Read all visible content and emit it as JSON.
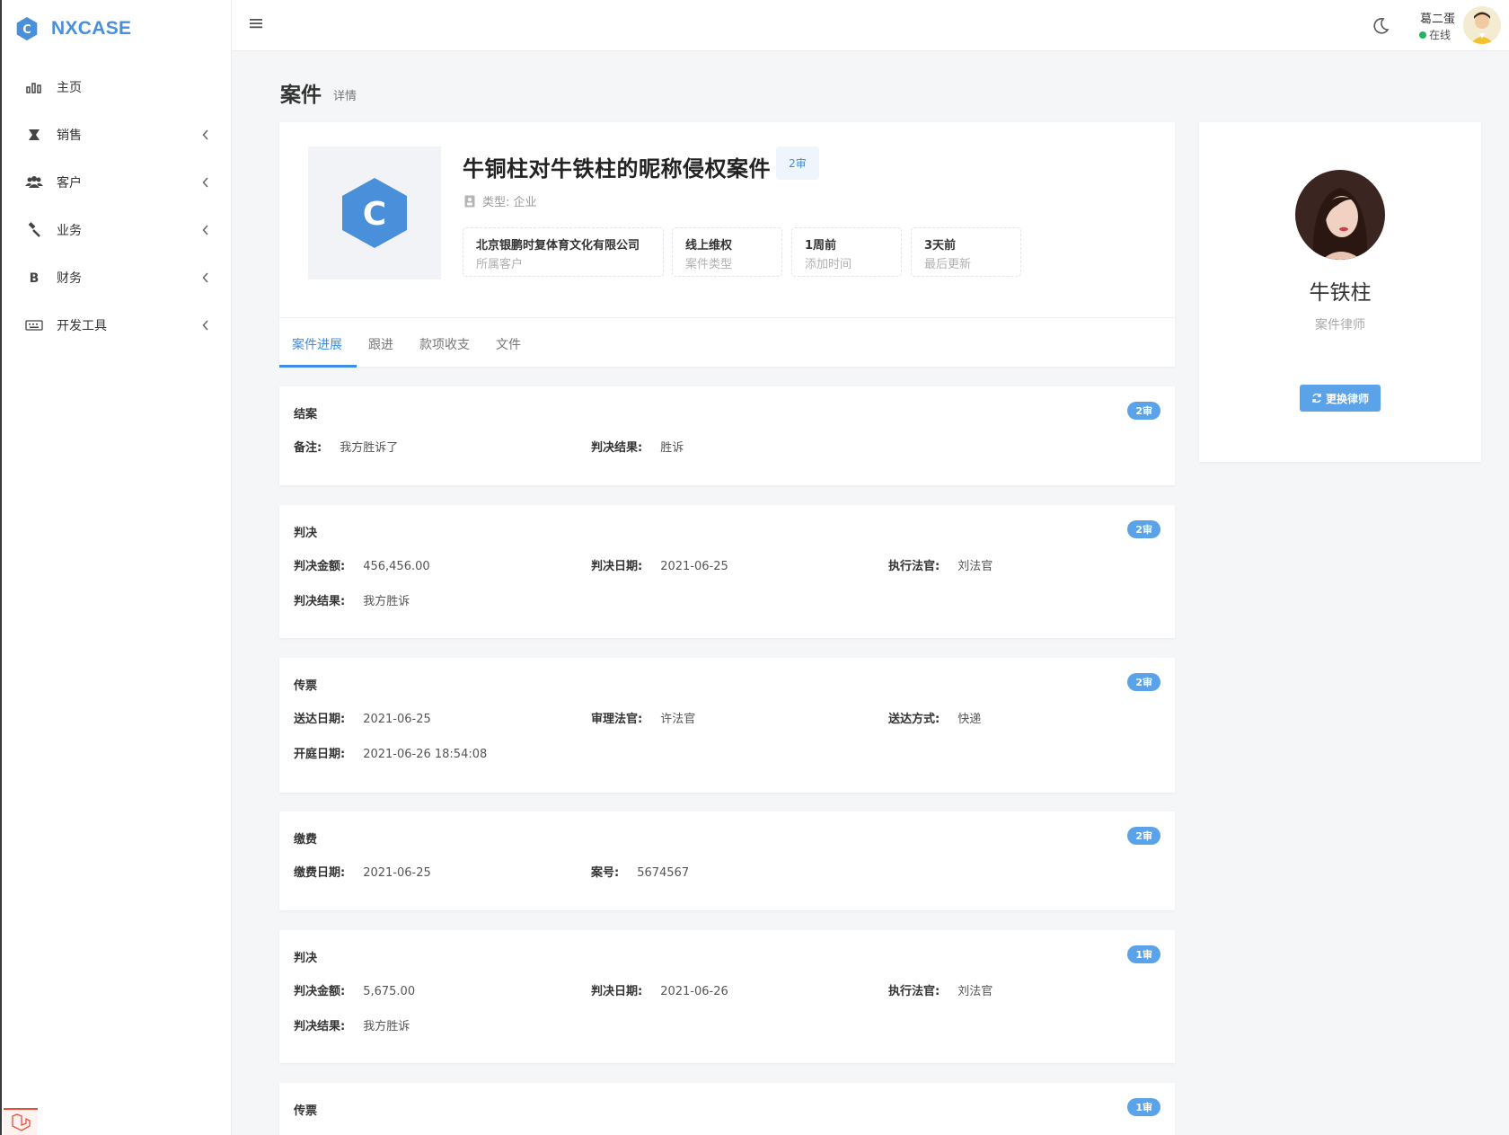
{
  "app": {
    "brand": "NXCASE"
  },
  "sidebar": {
    "items": [
      {
        "label": "主页",
        "icon": "bar-chart-icon",
        "has_children": false
      },
      {
        "label": "销售",
        "icon": "flask-icon",
        "has_children": true
      },
      {
        "label": "客户",
        "icon": "users-icon",
        "has_children": true
      },
      {
        "label": "业务",
        "icon": "gavel-icon",
        "has_children": true
      },
      {
        "label": "财务",
        "icon": "bitcoin-icon",
        "has_children": true
      },
      {
        "label": "开发工具",
        "icon": "keyboard-icon",
        "has_children": true
      }
    ]
  },
  "header": {
    "user_name": "葛二蛋",
    "user_status": "在线"
  },
  "page": {
    "title": "案件",
    "subtitle": "详情"
  },
  "case": {
    "title": "牛铜柱对牛铁柱的昵称侵权案件",
    "badge": "2审",
    "type_text": "类型: 企业",
    "stats": [
      {
        "value": "北京银鹏时复体育文化有限公司",
        "label": "所属客户"
      },
      {
        "value": "线上维权",
        "label": "案件类型"
      },
      {
        "value": "1周前",
        "label": "添加时间"
      },
      {
        "value": "3天前",
        "label": "最后更新"
      }
    ],
    "tabs": [
      "案件进展",
      "跟进",
      "款项收支",
      "文件"
    ],
    "active_tab": "案件进展"
  },
  "lawyer": {
    "name": "牛铁柱",
    "role": "案件律师",
    "change_button": "更换律师"
  },
  "progress": [
    {
      "title": "结案",
      "badge": "2审",
      "fields": [
        {
          "k": "备注:",
          "v": "我方胜诉了"
        },
        {
          "k": "判决结果:",
          "v": "胜诉"
        }
      ]
    },
    {
      "title": "判决",
      "badge": "2审",
      "fields": [
        {
          "k": "判决金额:",
          "v": "456,456.00"
        },
        {
          "k": "判决日期:",
          "v": "2021-06-25"
        },
        {
          "k": "执行法官:",
          "v": "刘法官"
        },
        {
          "k": "判决结果:",
          "v": "我方胜诉"
        }
      ]
    },
    {
      "title": "传票",
      "badge": "2审",
      "fields": [
        {
          "k": "送达日期:",
          "v": "2021-06-25"
        },
        {
          "k": "审理法官:",
          "v": "许法官"
        },
        {
          "k": "送达方式:",
          "v": "快递"
        },
        {
          "k": "开庭日期:",
          "v": "2021-06-26 18:54:08"
        }
      ]
    },
    {
      "title": "缴费",
      "badge": "2审",
      "fields": [
        {
          "k": "缴费日期:",
          "v": "2021-06-25"
        },
        {
          "k": "案号:",
          "v": "5674567"
        }
      ]
    },
    {
      "title": "判决",
      "badge": "1审",
      "fields": [
        {
          "k": "判决金额:",
          "v": "5,675.00"
        },
        {
          "k": "判决日期:",
          "v": "2021-06-26"
        },
        {
          "k": "执行法官:",
          "v": "刘法官"
        },
        {
          "k": "判决结果:",
          "v": "我方胜诉"
        }
      ]
    },
    {
      "title": "传票",
      "badge": "1审",
      "fields": []
    }
  ]
}
